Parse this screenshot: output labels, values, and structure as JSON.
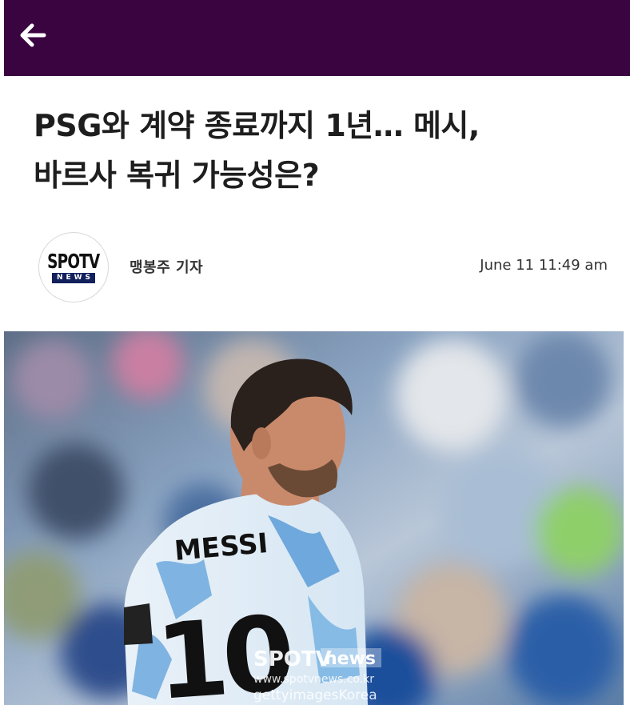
{
  "header": {
    "background_color": "#3a0440",
    "back_icon": "arrow-left-icon"
  },
  "article": {
    "title_line1": "PSG와 계약 종료까지 1년… 메시,",
    "title_line2": "바르사 복귀 가능성은?",
    "source_logo": {
      "top": "SPOTV",
      "bottom": "NEWS"
    },
    "reporter": "맹봉주 기자",
    "timestamp": "June 11 11:49 am"
  },
  "photo": {
    "jersey_name": "MESSI",
    "jersey_number": "10",
    "watermark_brand": "SPOTV",
    "watermark_news": "news",
    "watermark_url": "www.spotvnews.co.kr",
    "watermark_credit": "gettyimagesKorea"
  }
}
